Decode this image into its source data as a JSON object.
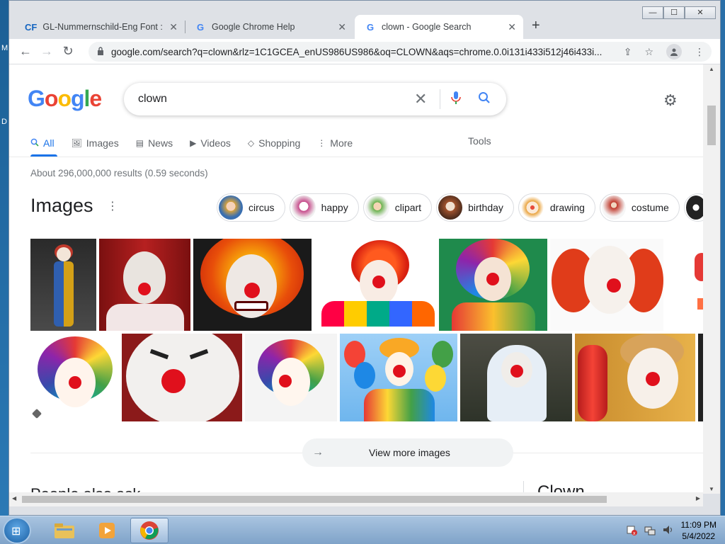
{
  "desktop": {
    "left_letters": [
      "M",
      "D"
    ]
  },
  "window_controls": {
    "minimize": "—",
    "maximize": "☐",
    "close": "✕"
  },
  "tabs": [
    {
      "favicon": "CF",
      "title": "GL-Nummernschild-Eng Font : D",
      "close": "✕"
    },
    {
      "favicon": "G",
      "title": "Google Chrome Help",
      "close": "✕"
    },
    {
      "favicon": "G",
      "title": "clown - Google Search",
      "close": "✕"
    }
  ],
  "new_tab": "+",
  "toolbar": {
    "back": "←",
    "forward": "→",
    "reload": "↻",
    "url": "google.com/search?q=clown&rlz=1C1GCEA_enUS986US986&oq=CLOWN&aqs=chrome.0.0i131i433i512j46i433i..."
  },
  "google": {
    "logo": [
      "G",
      "o",
      "o",
      "g",
      "l",
      "e"
    ],
    "query": "clown",
    "nav": [
      {
        "label": "All",
        "icon": "search-icon"
      },
      {
        "label": "Images",
        "icon": "image-icon"
      },
      {
        "label": "News",
        "icon": "news-icon"
      },
      {
        "label": "Videos",
        "icon": "video-icon"
      },
      {
        "label": "Shopping",
        "icon": "tag-icon"
      },
      {
        "label": "More",
        "icon": "more-icon"
      }
    ],
    "tools": "Tools",
    "stats": "About 296,000,000 results (0.59 seconds)",
    "images_heading": "Images",
    "chips": [
      {
        "label": "circus",
        "color": "#d7a23c"
      },
      {
        "label": "happy",
        "color": "#c64a8a"
      },
      {
        "label": "clipart",
        "color": "#6ab04c"
      },
      {
        "label": "birthday",
        "color": "#a0522d"
      },
      {
        "label": "drawing",
        "color": "#e9a23b"
      },
      {
        "label": "costume",
        "color": "#c0392b"
      }
    ],
    "view_more": "View more images",
    "people_also_ask": "People also ask",
    "panel_title": "Clown"
  },
  "taskbar": {
    "time": "11:09 PM",
    "date": "5/4/2022"
  }
}
